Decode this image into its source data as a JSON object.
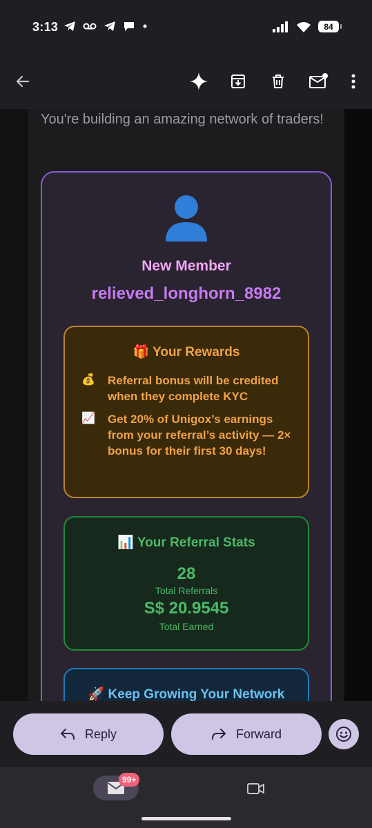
{
  "status_bar": {
    "time": "3:13",
    "battery": "84"
  },
  "app_bar": {
    "icons": [
      "back-arrow-icon",
      "sparkle-icon",
      "archive-icon",
      "delete-icon",
      "mark-unread-icon",
      "more-vert-icon"
    ]
  },
  "email": {
    "intro": "You're building an amazing network of traders!",
    "member": {
      "label": "New Member",
      "username": "relieved_longhorn_8982"
    },
    "rewards": {
      "title": "🎁 Your Rewards",
      "items": [
        {
          "emoji": "💰",
          "text": "Referral bonus will be credited when they complete KYC"
        },
        {
          "emoji": "📈",
          "text": "Get 20% of Unigox’s earnings from your referral’s activity — 2× bonus for their first 30 days!"
        }
      ]
    },
    "stats": {
      "title": "📊 Your Referral Stats",
      "total_referrals_value": "28",
      "total_referrals_label": "Total Referrals",
      "total_earned_value": "S$ 20.9545",
      "total_earned_label": "Total Earned"
    },
    "grow": {
      "title": "🚀 Keep Growing Your Network"
    }
  },
  "reply_bar": {
    "reply_label": "Reply",
    "forward_label": "Forward"
  },
  "bottom_nav": {
    "mail_badge": "99+"
  },
  "colors": {
    "accent_purple": "#8a5cd8",
    "rewards_orange": "#f0a24b",
    "stats_green": "#4cb868",
    "grow_blue": "#6cc0f0"
  }
}
